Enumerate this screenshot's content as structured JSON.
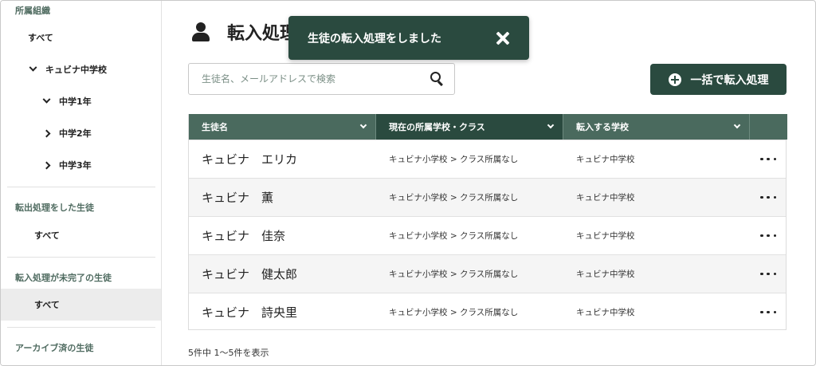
{
  "sidebar": {
    "org_title": "所属組織",
    "org_items": [
      {
        "label": "すべて"
      },
      {
        "label": "キュビナ中学校"
      },
      {
        "label": "中学1年"
      },
      {
        "label": "中学2年"
      },
      {
        "label": "中学3年"
      }
    ],
    "transferred_out_title": "転出処理をした生徒",
    "transferred_out_all": "すべて",
    "transfer_pending_title": "転入処理が未完了の生徒",
    "transfer_pending_all": "すべて",
    "archived_title": "アーカイブ済の生徒"
  },
  "header": {
    "title": "転入処理"
  },
  "toast": {
    "message": "生徒の転入処理をしました"
  },
  "search": {
    "placeholder": "生徒名、メールアドレスで検索",
    "value": ""
  },
  "bulk_button": {
    "label": "一括で転入処理"
  },
  "table": {
    "columns": [
      "生徒名",
      "現在の所属学校・クラス",
      "転入する学校"
    ],
    "rows": [
      {
        "name": "キュビナ　エリカ",
        "current": "キュビナ小学校 > クラス所属なし",
        "destination": "キュビナ中学校"
      },
      {
        "name": "キュビナ　薫",
        "current": "キュビナ小学校 > クラス所属なし",
        "destination": "キュビナ中学校"
      },
      {
        "name": "キュビナ　佳奈",
        "current": "キュビナ小学校 > クラス所属なし",
        "destination": "キュビナ中学校"
      },
      {
        "name": "キュビナ　健太郎",
        "current": "キュビナ小学校 > クラス所属なし",
        "destination": "キュビナ中学校"
      },
      {
        "name": "キュビナ　詩央里",
        "current": "キュビナ小学校 > クラス所属なし",
        "destination": "キュビナ中学校"
      }
    ]
  },
  "pagination": {
    "summary": "5件中 1〜5件を表示"
  },
  "colors": {
    "primary": "#2a4a3f",
    "header_bg": "#4a6a5e",
    "section_title": "#4f6b60",
    "active_bg": "#ececec"
  }
}
